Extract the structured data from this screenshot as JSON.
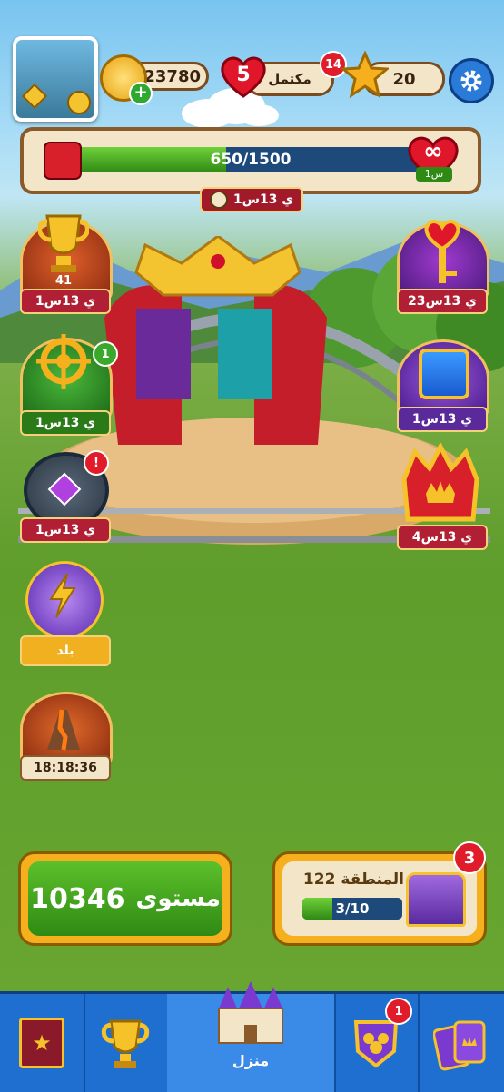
{
  "header": {
    "coins": "23780",
    "lives_count": "5",
    "lives_label": "مكتمل",
    "lives_badge": "14",
    "stars": "20"
  },
  "progress": {
    "value_text": "650/1500",
    "fraction": 0.433,
    "infinite_symbol": "∞",
    "infinite_timer": "1س",
    "event_timer": "1ي 13س"
  },
  "events_left": [
    {
      "name": "trophy",
      "count": "41",
      "timer": "1ي 13س"
    },
    {
      "name": "ship-wheel",
      "badge": "1",
      "timer": "1ي 13س"
    },
    {
      "name": "gem-vault",
      "badge": "!",
      "timer": "1ي 13س"
    },
    {
      "name": "lightning",
      "timer": "بلد"
    },
    {
      "name": "volcano",
      "timer": "18:18:36"
    }
  ],
  "events_right": [
    {
      "name": "key-heart",
      "timer": "23ي 13س"
    },
    {
      "name": "treasure-box",
      "timer": "1ي 13س"
    },
    {
      "name": "crown",
      "timer": "4ي 13س"
    }
  ],
  "play_button": {
    "label": "مستوى",
    "level": "10346"
  },
  "area": {
    "label": "المنطقة",
    "number": "122",
    "progress_text": "3/10",
    "progress_fraction": 0.3,
    "badge": "3"
  },
  "nav": {
    "home_label": "منزل",
    "team_badge": "1"
  },
  "colors": {
    "nav_blue": "#1f6fd0",
    "play_green": "#3e9a14",
    "accent_gold": "#f4b52a"
  }
}
